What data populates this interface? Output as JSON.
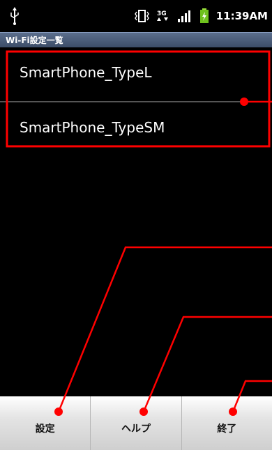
{
  "status_bar": {
    "time": "11:39AM",
    "icons": [
      "usb-icon",
      "vibrate-icon",
      "network-3g-icon",
      "signal-icon",
      "battery-charging-icon"
    ]
  },
  "title_bar": {
    "title": "Wi-Fi設定一覧"
  },
  "wifi_list": {
    "items": [
      {
        "label": "SmartPhone_TypeL"
      },
      {
        "label": "SmartPhone_TypeSM"
      }
    ]
  },
  "menu": {
    "items": [
      {
        "label": "設定"
      },
      {
        "label": "ヘルプ"
      },
      {
        "label": "終了"
      }
    ]
  },
  "colors": {
    "background": "#000000",
    "annotation": "#ff0000",
    "titlebar": "#4a5c7a"
  }
}
